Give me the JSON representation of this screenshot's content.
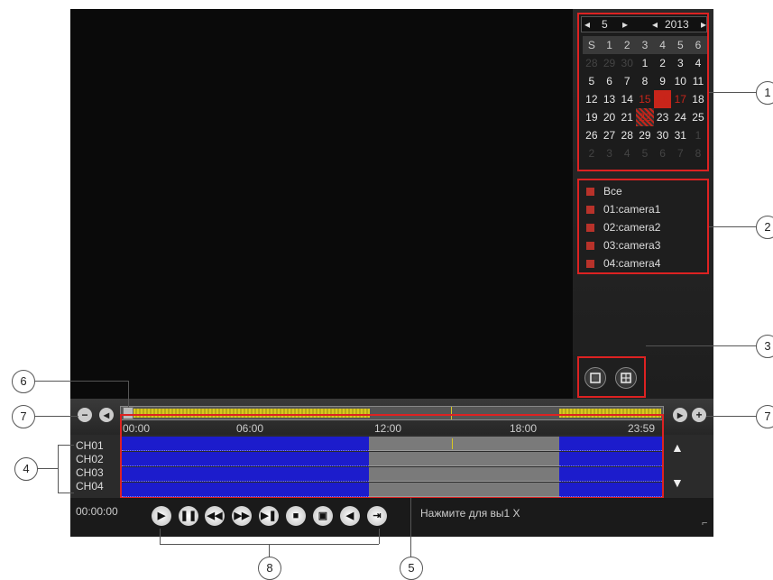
{
  "calendar": {
    "month": "5",
    "year": "2013",
    "weekdays": [
      "S",
      "1",
      "2",
      "3",
      "4",
      "5",
      "6"
    ],
    "rows": [
      [
        "28",
        "29",
        "30",
        "1",
        "2",
        "3",
        "4"
      ],
      [
        "5",
        "6",
        "7",
        "8",
        "9",
        "10",
        "11"
      ],
      [
        "12",
        "13",
        "14",
        "15",
        "16",
        "17",
        "18"
      ],
      [
        "19",
        "20",
        "21",
        "22",
        "23",
        "24",
        "25"
      ],
      [
        "26",
        "27",
        "28",
        "29",
        "30",
        "31",
        "1"
      ],
      [
        "2",
        "3",
        "4",
        "5",
        "6",
        "7",
        "8"
      ]
    ],
    "colors": {
      "border": "#dd2222",
      "record_day": "#c8251a"
    }
  },
  "channels": {
    "items": [
      "Все",
      "01:camera1",
      "02:camera2",
      "03:camera3",
      "04:camera4"
    ]
  },
  "timeline": {
    "ticks": [
      "00:00",
      "06:00",
      "12:00",
      "18:00",
      "23:59"
    ],
    "rows": [
      "CH01",
      "CH02",
      "CH03",
      "CH04"
    ]
  },
  "controls": {
    "time": "00:00:00",
    "hint": "Нажмите для вы1 Х"
  },
  "callouts": [
    "1",
    "2",
    "3",
    "4",
    "5",
    "6",
    "7",
    "7",
    "8"
  ]
}
